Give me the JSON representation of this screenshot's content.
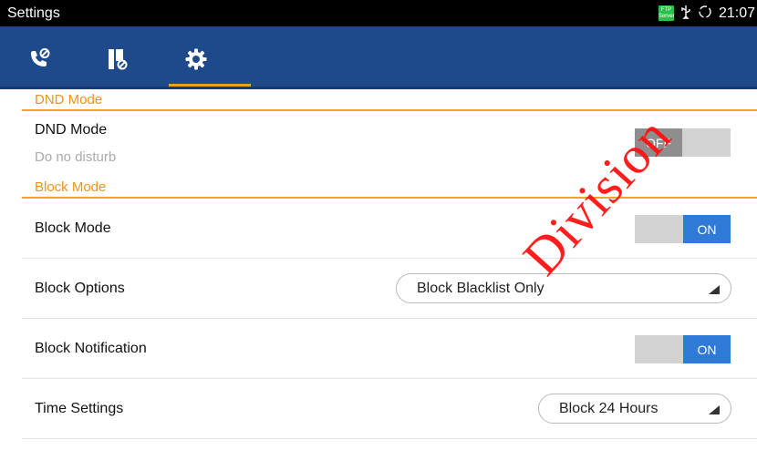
{
  "statusbar": {
    "title": "Settings",
    "ftp_badge_top": "FTP",
    "ftp_badge_bottom": "Server",
    "usb_icon": "usb-icon",
    "sync_icon": "sync-icon",
    "time": "21:07"
  },
  "tabs": [
    {
      "icon": "phone-dnd-icon",
      "active": false
    },
    {
      "icon": "contacts-block-icon",
      "active": false
    },
    {
      "icon": "gear-icon",
      "active": true
    }
  ],
  "colors": {
    "tabbar": "#1e4a8c",
    "accent": "#f0a421",
    "toggle_on": "#2f7ad6",
    "toggle_off": "#8e8e8e"
  },
  "dnd_section": {
    "header": "DND Mode",
    "row": {
      "label": "DND Mode",
      "sublabel": "Do no disturb",
      "toggle": "OFF"
    }
  },
  "block_section": {
    "header": "Block Mode",
    "rows": [
      {
        "label": "Block Mode",
        "toggle": "ON"
      },
      {
        "label": "Block Options",
        "value": "Block Blacklist Only"
      },
      {
        "label": "Block Notification",
        "toggle": "ON"
      },
      {
        "label": "Time Settings",
        "value": "Block 24 Hours"
      }
    ]
  },
  "watermark": "Division"
}
